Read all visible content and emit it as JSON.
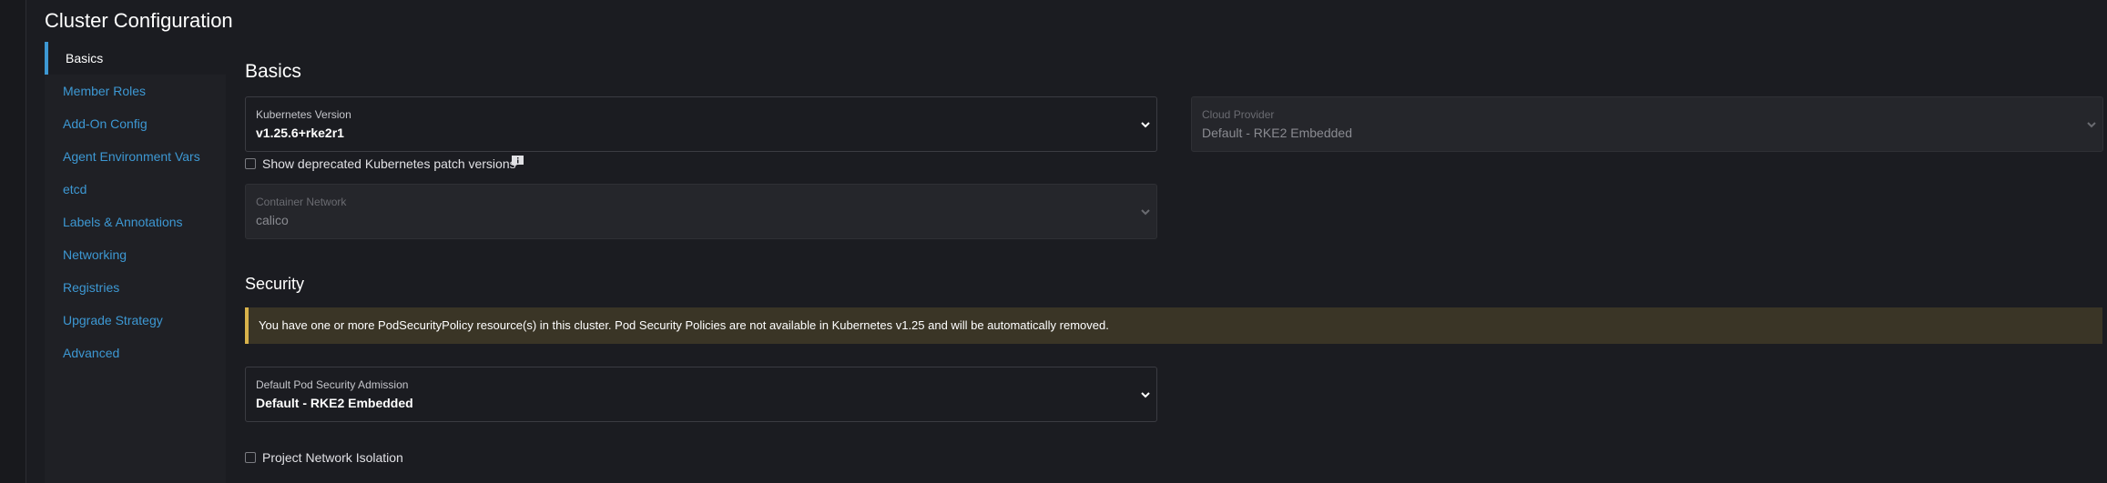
{
  "page": {
    "title": "Cluster Configuration"
  },
  "sidebar": {
    "items": [
      {
        "label": "Basics",
        "active": true
      },
      {
        "label": "Member Roles"
      },
      {
        "label": "Add-On Config"
      },
      {
        "label": "Agent Environment Vars"
      },
      {
        "label": "etcd"
      },
      {
        "label": "Labels & Annotations"
      },
      {
        "label": "Networking"
      },
      {
        "label": "Registries"
      },
      {
        "label": "Upgrade Strategy"
      },
      {
        "label": "Advanced"
      }
    ]
  },
  "basics": {
    "heading": "Basics",
    "kubernetes_version": {
      "label": "Kubernetes Version",
      "value": "v1.25.6+rke2r1"
    },
    "cloud_provider": {
      "label": "Cloud Provider",
      "value": "Default - RKE2 Embedded",
      "disabled": true
    },
    "show_deprecated": {
      "label": "Show deprecated Kubernetes patch versions",
      "checked": false
    },
    "container_network": {
      "label": "Container Network",
      "value": "calico",
      "disabled": true
    }
  },
  "security": {
    "heading": "Security",
    "warning": "You have one or more PodSecurityPolicy resource(s) in this cluster. Pod Security Policies are not available in Kubernetes v1.25 and will be automatically removed.",
    "pod_security_admission": {
      "label": "Default Pod Security Admission",
      "value": "Default - RKE2 Embedded"
    },
    "project_network_isolation": {
      "label": "Project Network Isolation",
      "checked": false
    }
  },
  "colors": {
    "accent": "#3d98d3",
    "warning": "#d8b24b",
    "background": "#1b1c21"
  },
  "icons": {
    "chevron": "chevron-down-icon",
    "info": "info-icon"
  }
}
